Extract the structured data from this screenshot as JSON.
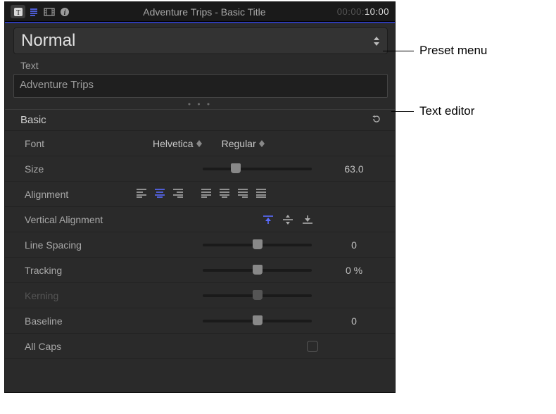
{
  "header": {
    "title": "Adventure Trips - Basic Title",
    "timecode_gray": "00:00:",
    "timecode_white": "10:00"
  },
  "preset": {
    "value": "Normal"
  },
  "text_section": {
    "label": "Text",
    "value": "Adventure Trips"
  },
  "basic": {
    "title": "Basic",
    "font_label": "Font",
    "font_family": "Helvetica",
    "font_weight": "Regular",
    "size_label": "Size",
    "size_value": "63.0",
    "alignment_label": "Alignment",
    "valign_label": "Vertical Alignment",
    "line_spacing_label": "Line Spacing",
    "line_spacing_value": "0",
    "tracking_label": "Tracking",
    "tracking_value": "0  %",
    "kerning_label": "Kerning",
    "baseline_label": "Baseline",
    "baseline_value": "0",
    "allcaps_label": "All Caps"
  },
  "callouts": {
    "preset": "Preset menu",
    "editor": "Text editor"
  }
}
